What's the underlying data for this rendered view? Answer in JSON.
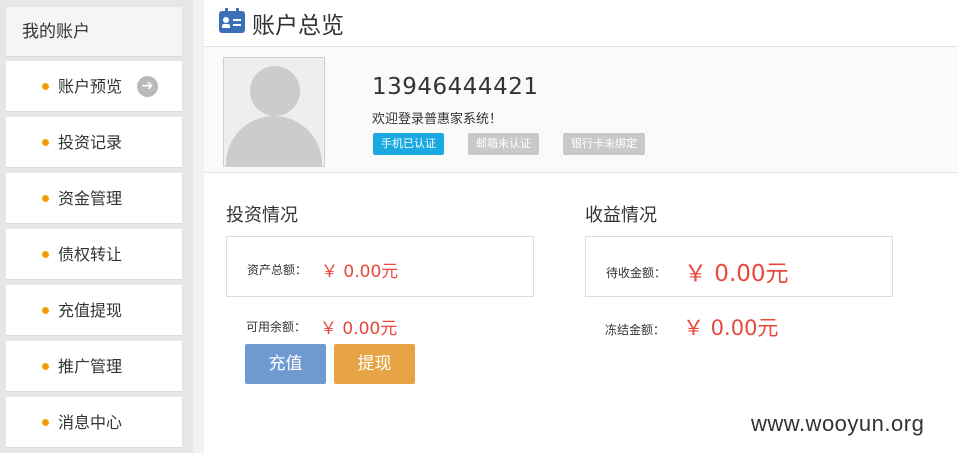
{
  "sidebar": {
    "header": "我的账户",
    "items": [
      {
        "label": "账户预览",
        "active": true
      },
      {
        "label": "投资记录"
      },
      {
        "label": "资金管理"
      },
      {
        "label": "债权转让"
      },
      {
        "label": "充值提现"
      },
      {
        "label": "推广管理"
      },
      {
        "label": "消息中心"
      }
    ],
    "arrow_glyph": "➔"
  },
  "header": {
    "title": "账户总览"
  },
  "profile": {
    "phone": "13946444421",
    "welcome": "欢迎登录普惠家系统！",
    "badges": [
      {
        "label": "手机已认证",
        "status": "verified"
      },
      {
        "label": "邮箱未认证",
        "status": "unverified"
      },
      {
        "label": "银行卡未绑定",
        "status": "unverified"
      }
    ]
  },
  "investment": {
    "title": "投资情况",
    "total_assets_label": "资产总额：",
    "total_assets_value": "￥ 0.00元",
    "available_label": "可用余额：",
    "available_value": "￥ 0.00元"
  },
  "income": {
    "title": "收益情况",
    "pending_label": "待收金额：",
    "pending_value": "￥ 0.00元",
    "frozen_label": "冻结金额：",
    "frozen_value": "￥ 0.00元"
  },
  "actions": {
    "recharge": "充值",
    "withdraw": "提现"
  },
  "watermark": "www.wooyun.org",
  "colors": {
    "accent_blue": "#1ba9e1",
    "money_red": "#e8473d",
    "button_blue": "#6f9ad0",
    "button_orange": "#e6a444",
    "bullet_orange": "#f39c12"
  }
}
